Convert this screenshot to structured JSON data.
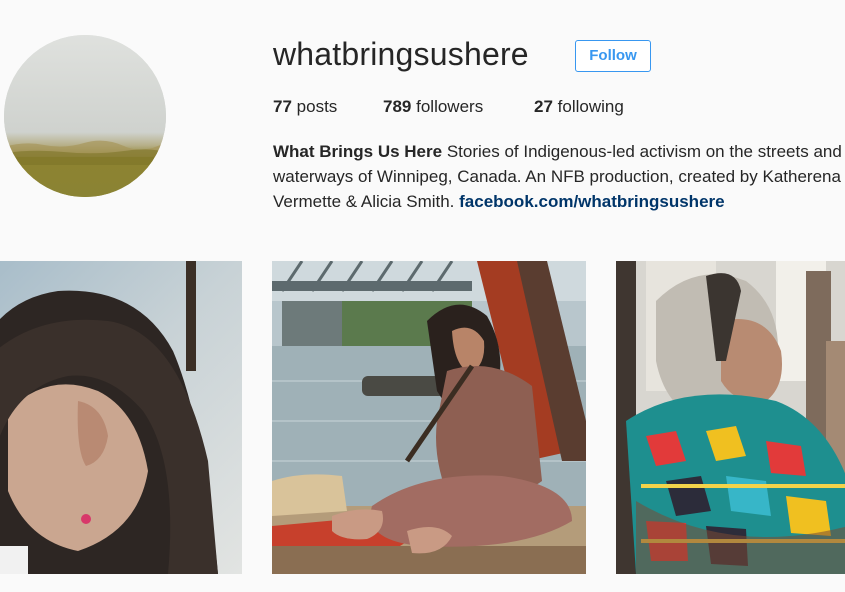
{
  "profile": {
    "username": "whatbringsushere",
    "follow_label": "Follow",
    "stats": {
      "posts_count": "77",
      "posts_label": "posts",
      "followers_count": "789",
      "followers_label": "followers",
      "following_count": "27",
      "following_label": "following"
    },
    "bio": {
      "name": "What Brings Us Here",
      "line1_text": " Stories of Indigenous-led activism on the streets and",
      "line2_text": "waterways of Winnipeg, Canada. An NFB production, created by Katherena",
      "line3_text": "Vermette & Alicia Smith. ",
      "link": "facebook.com/whatbringsushere"
    }
  },
  "posts": [
    {
      "subject": "woman-back-of-head-photo"
    },
    {
      "subject": "woman-playing-flute-by-river-photo"
    },
    {
      "subject": "elder-woman-in-patterned-jacket-photo"
    }
  ],
  "colors": {
    "accent": "#3897f0",
    "link": "#003569",
    "background": "#fafafa",
    "text": "#262626"
  }
}
